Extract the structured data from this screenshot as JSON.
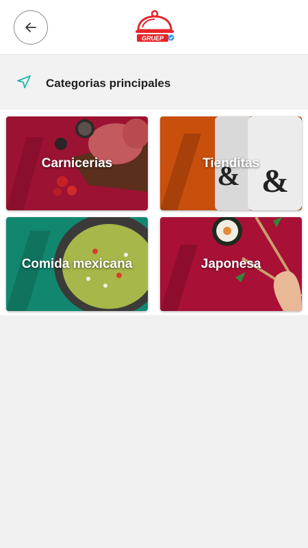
{
  "header": {
    "back_icon": "arrow-left-icon",
    "logo_text": "GRUEP",
    "brand_color": "#e5252a"
  },
  "section": {
    "icon": "navigation-arrow-icon",
    "title": "Categorias principales",
    "accent": "#1bb8a8"
  },
  "categories": [
    {
      "label": "Carnicerias"
    },
    {
      "label": "Tienditas"
    },
    {
      "label": "Comida mexicana"
    },
    {
      "label": "Japonesa"
    }
  ]
}
